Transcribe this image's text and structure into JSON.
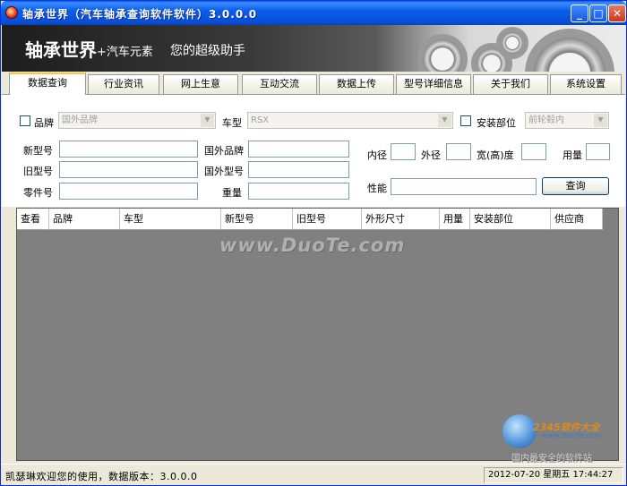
{
  "window": {
    "title": "轴承世界（汽车轴承查询软件软件）3.0.0.0"
  },
  "banner": {
    "title": "轴承世界",
    "subtitle": "+汽车元素",
    "slogan": "您的超级助手"
  },
  "tabs": [
    {
      "label": "数据查询",
      "active": true
    },
    {
      "label": "行业资讯"
    },
    {
      "label": "网上生意"
    },
    {
      "label": "互动交流"
    },
    {
      "label": "数据上传"
    },
    {
      "label": "型号详细信息"
    },
    {
      "label": "关于我们"
    },
    {
      "label": "系统设置"
    }
  ],
  "filters": {
    "brand_label": "品牌",
    "brand_value": "国外品牌",
    "model_label": "车型",
    "model_value": "RSX",
    "position_label": "安装部位",
    "position_value": "前轮毂内"
  },
  "fields": {
    "new_model": "新型号",
    "old_model": "旧型号",
    "part_no": "零件号",
    "foreign_brand": "国外品牌",
    "foreign_model": "国外型号",
    "weight": "重量",
    "inner": "内径",
    "outer": "外径",
    "width": "宽(高)度",
    "usage": "用量",
    "performance": "性能"
  },
  "buttons": {
    "search": "查询"
  },
  "grid": {
    "columns": [
      "查看",
      "品牌",
      "车型",
      "新型号",
      "旧型号",
      "外形尺寸",
      "用量",
      "安装部位",
      "供应商"
    ],
    "watermark": "www.DuoTe.com"
  },
  "corner_logo": {
    "brand": "2345软件大全",
    "url": "www.DuoTe.com",
    "tag": "国内最安全的软件站"
  },
  "status": {
    "left": "凯瑟琳欢迎您的使用，数据版本：3.0.0.0",
    "right": "2012-07-20  星期五  17:44:27"
  },
  "colors": {
    "titlebar": "#0a5ce6",
    "tab_highlight": "#ffc83c",
    "grid_bg": "#808080"
  }
}
